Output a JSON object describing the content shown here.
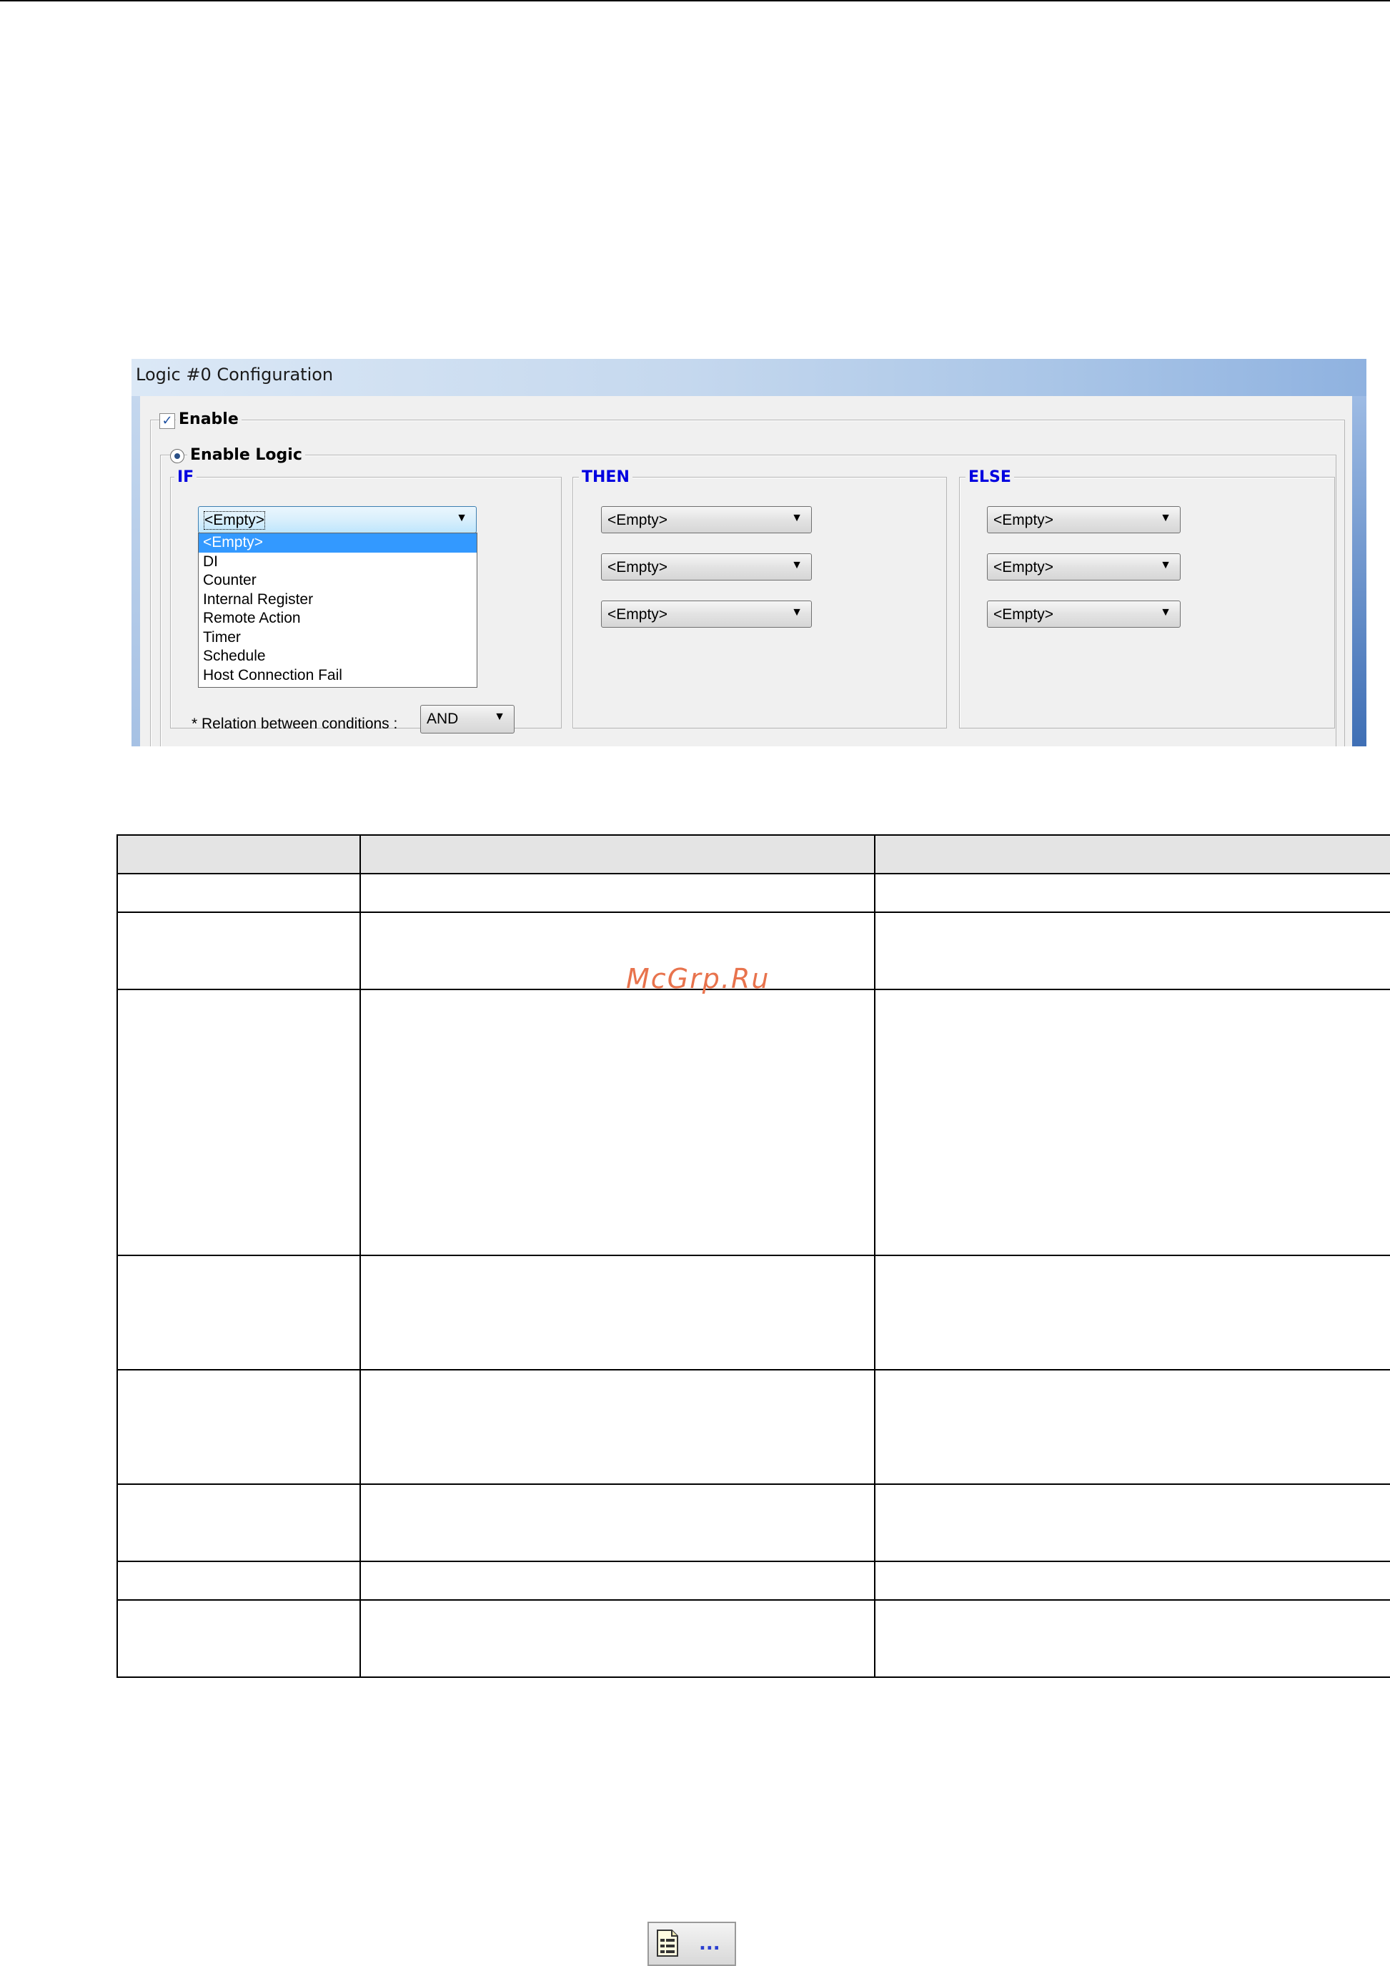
{
  "dialog": {
    "title": "Logic #0 Configuration",
    "enable_label": "Enable",
    "enable_checked": true,
    "enable_logic_label": "Enable Logic",
    "sections": {
      "if": "IF",
      "then": "THEN",
      "else": "ELSE"
    },
    "if_combo_value": "<Empty>",
    "if_dropdown_options": [
      "<Empty>",
      "DI",
      "Counter",
      "Internal Register",
      "Remote Action",
      "Timer",
      "Schedule",
      "Host Connection Fail"
    ],
    "if_dropdown_selected_index": 0,
    "then_combos": [
      "<Empty>",
      "<Empty>",
      "<Empty>"
    ],
    "else_combos": [
      "<Empty>",
      "<Empty>",
      "<Empty>"
    ],
    "relation_label": "* Relation between conditions :",
    "relation_value": "AND",
    "colors": {
      "caption_blue": "#0000e0",
      "selection": "#3399ff"
    }
  },
  "watermark": "McGrp.Ru",
  "toolbar_icon": {
    "icon": "document-properties-icon",
    "dots": "..."
  }
}
